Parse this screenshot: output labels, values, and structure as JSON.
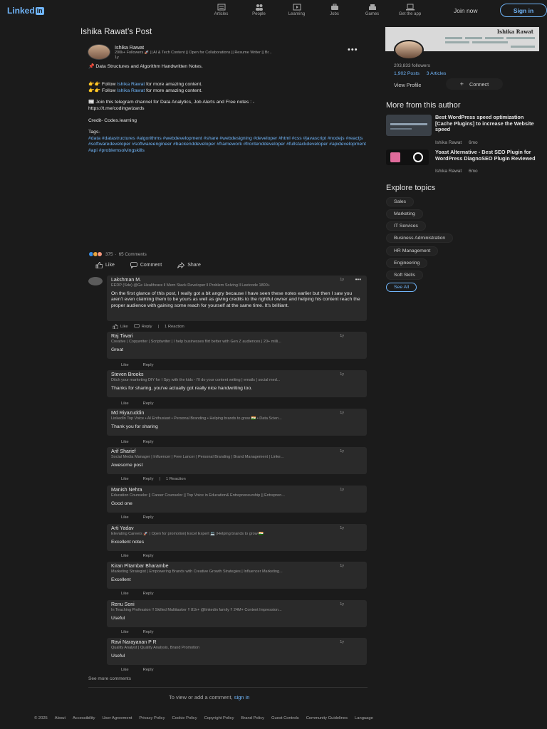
{
  "nav": {
    "logo_text": "Linked",
    "logo_in": "in",
    "items": [
      {
        "label": "Articles",
        "icon": "articles-icon"
      },
      {
        "label": "People",
        "icon": "people-icon"
      },
      {
        "label": "Learning",
        "icon": "learning-icon"
      },
      {
        "label": "Jobs",
        "icon": "jobs-icon"
      },
      {
        "label": "Games",
        "icon": "games-icon"
      },
      {
        "label": "Get the app",
        "icon": "laptop-icon"
      }
    ],
    "join_now": "Join now",
    "sign_in": "Sign in"
  },
  "post": {
    "page_title": "Ishika Rawat’s Post",
    "author_name": "Ishika Rawat",
    "author_headline": "200k+ Followers 🚀 || AI & Tech Content || Open for Collaborations || Resume Writer || Br...",
    "time": "1y",
    "line1": "📌 Data Structures and Algorithm Handwritten Notes.",
    "follow_prefix": "👉👉 Follow ",
    "follow_link": "Ishika Rawat",
    "follow_suffix": " for more amazing content.",
    "telegram": "📰 Join this telegram channel for Data Analytics, Job Alerts and Free notes : -",
    "telegram_url": "https://t.me/codingwizards",
    "credit": "Credit- Codes.learning",
    "tags_label": "Tags-",
    "tags": "#data #datastructures #algorithms #webdevelopment #share #webdesigning #developer #html #css #javascript #nodejs #reactjs #softwaredeveloper #softwareengineer #backenddeveloper #framework #frontenddeveloper #fullstackdeveloper #apidevelopment #api #problemsolvingskills",
    "reaction_count": "375",
    "comment_count": "65 Comments",
    "actions": {
      "like": "Like",
      "comment": "Comment",
      "share": "Share"
    }
  },
  "comments": [
    {
      "name": "Lakshman M.",
      "headline": "EEDP (Sde) @Ge Healthcare ll Mern Stack Developer ll Problem Solving ll Leetcode 1800+",
      "time": "1y",
      "text": "On the first glance of this post, I really got a bit angry  because I have seen these notes earlier but then I saw you aren't even claiming them to be yours as well as giving credits to the rightful owner and helping his content reach the proper audience with gaining some reach for yourself at the same time. It's brilliant.",
      "reactions": "1 Reaction"
    },
    {
      "name": "Raj Tiwari",
      "headline": "Creative | Copywriter | Scriptwriter | I help businesses flirt better with Gen Z audiences | 20+ milli...",
      "time": "1y",
      "text": "Great",
      "reactions": ""
    },
    {
      "name": "Steven Brooks",
      "headline": "Ditch your marketing DIY for I Spy with the kids - I'll do your content writing | emails | social med...",
      "time": "1y",
      "text": "Thanks for sharing, you've actually got really nice handwriting too.",
      "reactions": ""
    },
    {
      "name": "Md Riyazuddin",
      "headline": "LinkedIn Top Voice • AI Enthusiast • Personal Branding • Helping brands to grow 🇮🇳 • Data Scien...",
      "time": "1y",
      "text": "Thank you for sharing",
      "reactions": ""
    },
    {
      "name": "Arif Sharief",
      "headline": "Social Media Manager | Influencer | Free Lancer | Personal Branding | Brand Management | Linke...",
      "time": "1y",
      "text": "Awesome post",
      "reactions": "1 Reaction"
    },
    {
      "name": "Manish Nehra",
      "headline": "Education Counselor || Career Counselor || Top Voice in Education& Entrepreneurship || Entrepren...",
      "time": "1y",
      "text": "Good one",
      "reactions": ""
    },
    {
      "name": "Arti Yadav",
      "headline": "Elevating Careers 🚀 | Open for promotion| Excel Expert 💻 |Helping brands to grow 🇮🇳",
      "time": "1y",
      "text": "Excellent notes",
      "reactions": ""
    },
    {
      "name": "Kiran Pitambar Bharambe",
      "headline": "Marketing Strategist | Empowering Brands with Creative Growth Strategies | Influencer Marketing...",
      "time": "1y",
      "text": "Excellent",
      "reactions": ""
    },
    {
      "name": "Renu Soni",
      "headline": "In Teaching Profession !! Skilled Multitasker !! 81k+ @linkedin family !! 24M+ Content Impression...",
      "time": "1y",
      "text": "Useful",
      "reactions": ""
    },
    {
      "name": "Ravi Narayanan P R",
      "headline": "Quality Analyst | Quality Analysis, Brand Promotion",
      "time": "1y",
      "text": "Useful",
      "reactions": ""
    }
  ],
  "comment_actions": {
    "like": "Like",
    "reply": "Reply"
  },
  "see_more": "See more comments",
  "view_add_prefix": "To view or add a comment, ",
  "view_add_link": "sign in",
  "sidebar": {
    "banner_name": "Ishika Rawat",
    "followers": "203,833 followers",
    "posts": "1,902 Posts",
    "articles": "3 Articles",
    "view_profile": "View Profile",
    "connect": "Connect",
    "more_heading": "More from this author",
    "more_articles": [
      {
        "title": "Best WordPress speed optimization [Cache Plugins] to increase the Website speed",
        "author": "Ishika Rawat",
        "age": "6mo"
      },
      {
        "title": "Yoast Alternative - Best SEO Plugin for WordPress DiagnoSEO Plugin Reviewed",
        "author": "Ishika Rawat",
        "age": "6mo"
      }
    ],
    "explore_heading": "Explore topics",
    "topics": [
      "Sales",
      "Marketing",
      "IT Services",
      "Business Administration",
      "HR Management",
      "Engineering",
      "Soft Skills"
    ],
    "see_all": "See All"
  },
  "footer": [
    "© 2025",
    "About",
    "Accessibility",
    "User Agreement",
    "Privacy Policy",
    "Cookie Policy",
    "Copyright Policy",
    "Brand Policy",
    "Guest Controls",
    "Community Guidelines",
    "Language"
  ],
  "colors": {
    "background": "#1b1b1b",
    "accent": "#70b5f9",
    "card": "#2a2a2a"
  }
}
